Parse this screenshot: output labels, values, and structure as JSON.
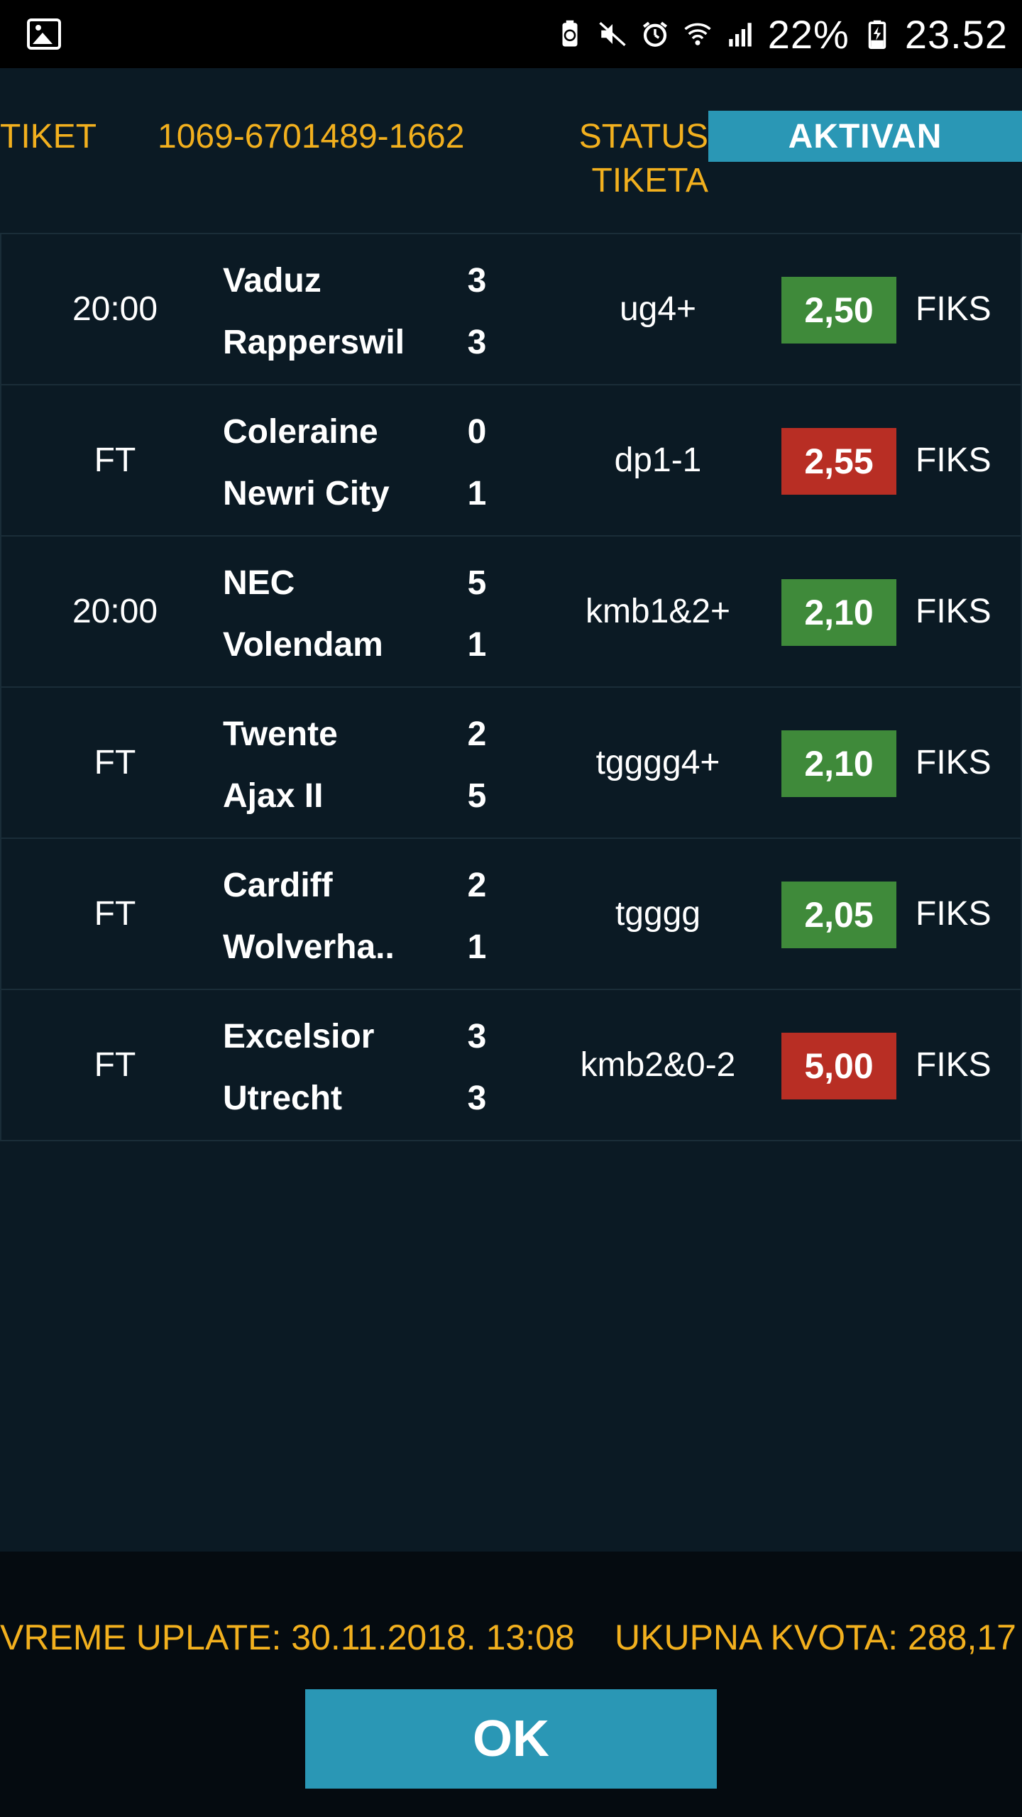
{
  "status_bar": {
    "battery_percent": "22%",
    "time": "23.52",
    "icons": [
      "gallery-icon",
      "battery-saver-icon",
      "mute-icon",
      "alarm-icon",
      "wifi-icon",
      "signal-icon",
      "battery-charging-icon"
    ]
  },
  "header": {
    "tiket_label": "TIKET",
    "tiket_number": "1069-6701489-1662",
    "status_label": "STATUS TIKETA",
    "status_value": "AKTIVAN",
    "status_color": "#2a97b5"
  },
  "matches": [
    {
      "time": "20:00",
      "home": "Vaduz",
      "away": "Rapperswil",
      "home_score": "3",
      "away_score": "3",
      "bet": "ug4+",
      "odds": "2,50",
      "result": "win",
      "type": "FIKS"
    },
    {
      "time": "FT",
      "home": "Coleraine",
      "away": "Newri City",
      "home_score": "0",
      "away_score": "1",
      "bet": "dp1-1",
      "odds": "2,55",
      "result": "lose",
      "type": "FIKS"
    },
    {
      "time": "20:00",
      "home": "NEC",
      "away": "Volendam",
      "home_score": "5",
      "away_score": "1",
      "bet": "kmb1&2+",
      "odds": "2,10",
      "result": "win",
      "type": "FIKS"
    },
    {
      "time": "FT",
      "home": "Twente",
      "away": "Ajax II",
      "home_score": "2",
      "away_score": "5",
      "bet": "tgggg4+",
      "odds": "2,10",
      "result": "win",
      "type": "FIKS"
    },
    {
      "time": "FT",
      "home": "Cardiff",
      "away": "Wolverha..",
      "home_score": "2",
      "away_score": "1",
      "bet": "tgggg",
      "odds": "2,05",
      "result": "win",
      "type": "FIKS"
    },
    {
      "time": "FT",
      "home": "Excelsior",
      "away": "Utrecht",
      "home_score": "3",
      "away_score": "3",
      "bet": "kmb2&0-2",
      "odds": "5,00",
      "result": "lose",
      "type": "FIKS"
    }
  ],
  "colors": {
    "win": "#3f8a3a",
    "lose": "#b82e24",
    "accent": "#f2b01e",
    "background": "#0b1a24"
  },
  "footer": {
    "vreme_uplate": "VREME UPLATE: 30.11.2018. 13:08",
    "ukupna_kvota": "UKUPNA KVOTA: 288,17",
    "ok_label": "OK"
  }
}
